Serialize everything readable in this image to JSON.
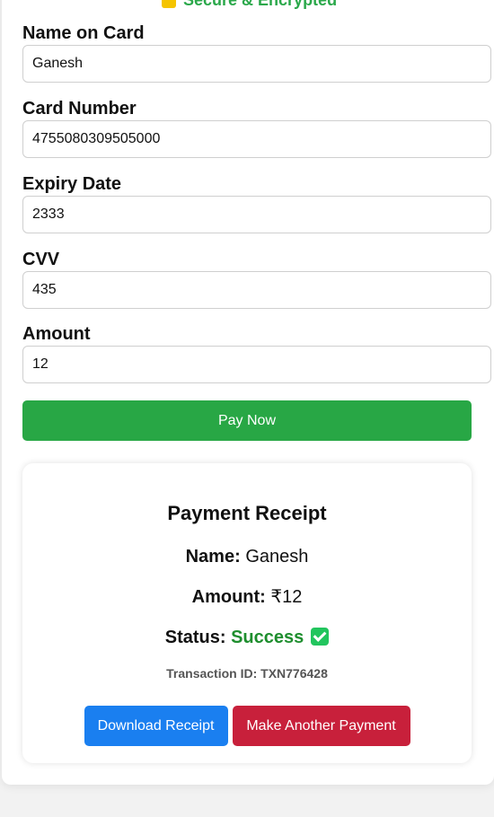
{
  "header": {
    "secure_text": "Secure & Encrypted"
  },
  "form": {
    "name": {
      "label": "Name on Card",
      "value": "Ganesh"
    },
    "card_number": {
      "label": "Card Number",
      "value": "4755080309505000"
    },
    "expiry": {
      "label": "Expiry Date",
      "value": "2333"
    },
    "cvv": {
      "label": "CVV",
      "value": "435"
    },
    "amount": {
      "label": "Amount",
      "value": "12"
    },
    "pay_button": "Pay Now"
  },
  "receipt": {
    "title": "Payment Receipt",
    "name_label": "Name:",
    "name_value": "Ganesh",
    "amount_label": "Amount:",
    "amount_value": "₹12",
    "status_label": "Status:",
    "status_value": "Success",
    "transaction": "Transaction ID: TXN776428",
    "download_button": "Download Receipt",
    "another_button": "Make Another Payment"
  },
  "colors": {
    "pay": "#28a745",
    "download": "#1a7ff0",
    "another": "#c8203b",
    "success": "#1e8e2e"
  },
  "icons": [
    "lock-icon",
    "check-icon"
  ]
}
